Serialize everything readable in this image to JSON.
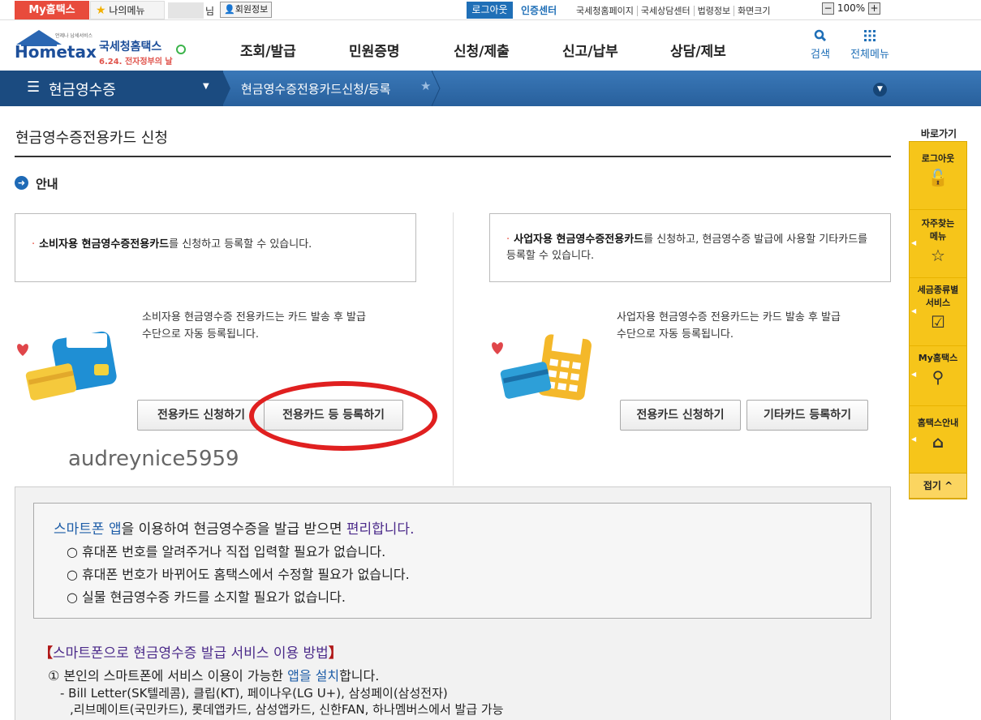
{
  "topbar": {
    "my_hometax": "My홈택스",
    "my_menu": "나의메뉴",
    "nim": "님",
    "member_info": "회원정보",
    "logout": "로그아웃",
    "cert_center": "인증센터",
    "links": [
      "국세청홈페이지",
      "국세상담센터",
      "법령정보",
      "화면크기"
    ],
    "zoom_level": "100%",
    "zoom_minus": "−",
    "zoom_plus": "+"
  },
  "header": {
    "logo_small": "언제나 납세서비스",
    "logo_main": "Hometax",
    "logo_kr": "국세청홈택스",
    "logo_event": "6.24. 전자정부의 날",
    "nav": [
      "조회/발급",
      "민원증명",
      "신청/제출",
      "신고/납부",
      "상담/제보"
    ],
    "search": "검색",
    "all_menu": "전체메뉴"
  },
  "navbar": {
    "section": "현금영수증",
    "breadcrumb": "현금영수증전용카드신청/등록"
  },
  "page": {
    "title": "현금영수증전용카드 신청",
    "guide_title": "안내"
  },
  "consumer": {
    "info_bold": "소비자용 현금영수증전용카드",
    "info_rest": "를 신청하고 등록할 수 있습니다.",
    "desc": "소비자용 현금영수증 전용카드는 카드 발송 후 발급\n수단으로 자동 등록됩니다.",
    "btn_apply": "전용카드 신청하기",
    "btn_register": "전용카드 등 등록하기"
  },
  "business": {
    "info_bold": "사업자용 현금영수증전용카드",
    "info_rest": "를 신청하고, 현금영수증 발급에 사용할 기타카드를 등록할 수 있습니다.",
    "desc": "사업자용 현금영수증 전용카드는 카드 발송 후 발급\n수단으로 자동 등록됩니다.",
    "btn_apply": "전용카드 신청하기",
    "btn_other": "기타카드 등록하기"
  },
  "watermark": "audreynice5959",
  "app_panel": {
    "intro_blue": "스마트폰 앱",
    "intro_mid": "을 이용하여 현금영수증을 발급 받으면 ",
    "intro_purple": "편리합니다.",
    "items": [
      "○ 휴대폰 번호를 알려주거나 직접 입력할 필요가 없습니다.",
      "○ 휴대폰 번호가 바뀌어도 홈택스에서 수정할 필요가 없습니다.",
      "○ 실물 현금영수증 카드를 소지할 필요가 없습니다."
    ]
  },
  "howto": {
    "bracket_open": "【",
    "title": "스마트폰으로 현금영수증 발급 서비스 이용 방법",
    "bracket_close": "】",
    "step1_a": "① 본인의 스마트폰에 서비스 이용이 가능한 ",
    "step1_blue": "앱을 설치",
    "step1_b": "합니다.",
    "apps_line1": "- Bill Letter(SK텔레콤), 클립(KT), 페이나우(LG U+), 삼성페이(삼성전자)",
    "apps_line2": ",리브메이트(국민카드), 롯데앱카드, 삼성앱카드, 신한FAN, 하나멤버스에서 발급 가능"
  },
  "quick": {
    "title": "바로가기",
    "items": [
      {
        "label": "로그아웃",
        "icon": "lock-icon"
      },
      {
        "label": "자주찾는 메뉴",
        "icon": "star-icon"
      },
      {
        "label": "세금종류별 서비스",
        "icon": "checkbox-icon"
      },
      {
        "label": "My홈택스",
        "icon": "person-icon"
      },
      {
        "label": "홈택스안내",
        "icon": "house-icon"
      }
    ],
    "fold": "접기"
  },
  "colors": {
    "accent_red": "#e84b3c",
    "brand_blue": "#1f6fb7",
    "quick_yellow": "#f6c51a"
  }
}
